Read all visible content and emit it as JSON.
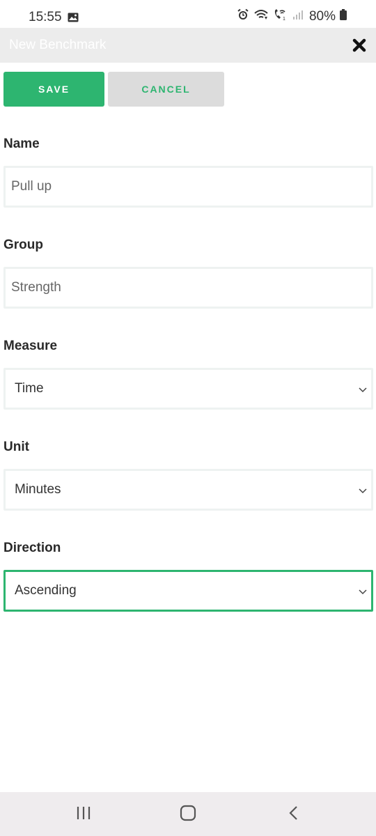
{
  "status": {
    "time": "15:55",
    "battery": "80%",
    "icons": [
      "gallery-icon",
      "alarm-icon",
      "wifi-icon",
      "wifi-call-icon",
      "signal-icon",
      "battery-icon"
    ]
  },
  "header": {
    "title": "New Benchmark",
    "close_icon": "close-icon"
  },
  "actions": {
    "save": "SAVE",
    "cancel": "CANCEL"
  },
  "form": {
    "name": {
      "label": "Name",
      "value": "Pull up"
    },
    "group": {
      "label": "Group",
      "value": "Strength"
    },
    "measure": {
      "label": "Measure",
      "value": "Time"
    },
    "unit": {
      "label": "Unit",
      "value": "Minutes"
    },
    "direction": {
      "label": "Direction",
      "value": "Ascending"
    }
  },
  "colors": {
    "accent": "#2db570",
    "header_bg": "#ececec",
    "cancel_bg": "#dcdcdc"
  },
  "navbar": {
    "icons": [
      "recent-apps-icon",
      "home-icon",
      "back-icon"
    ]
  }
}
